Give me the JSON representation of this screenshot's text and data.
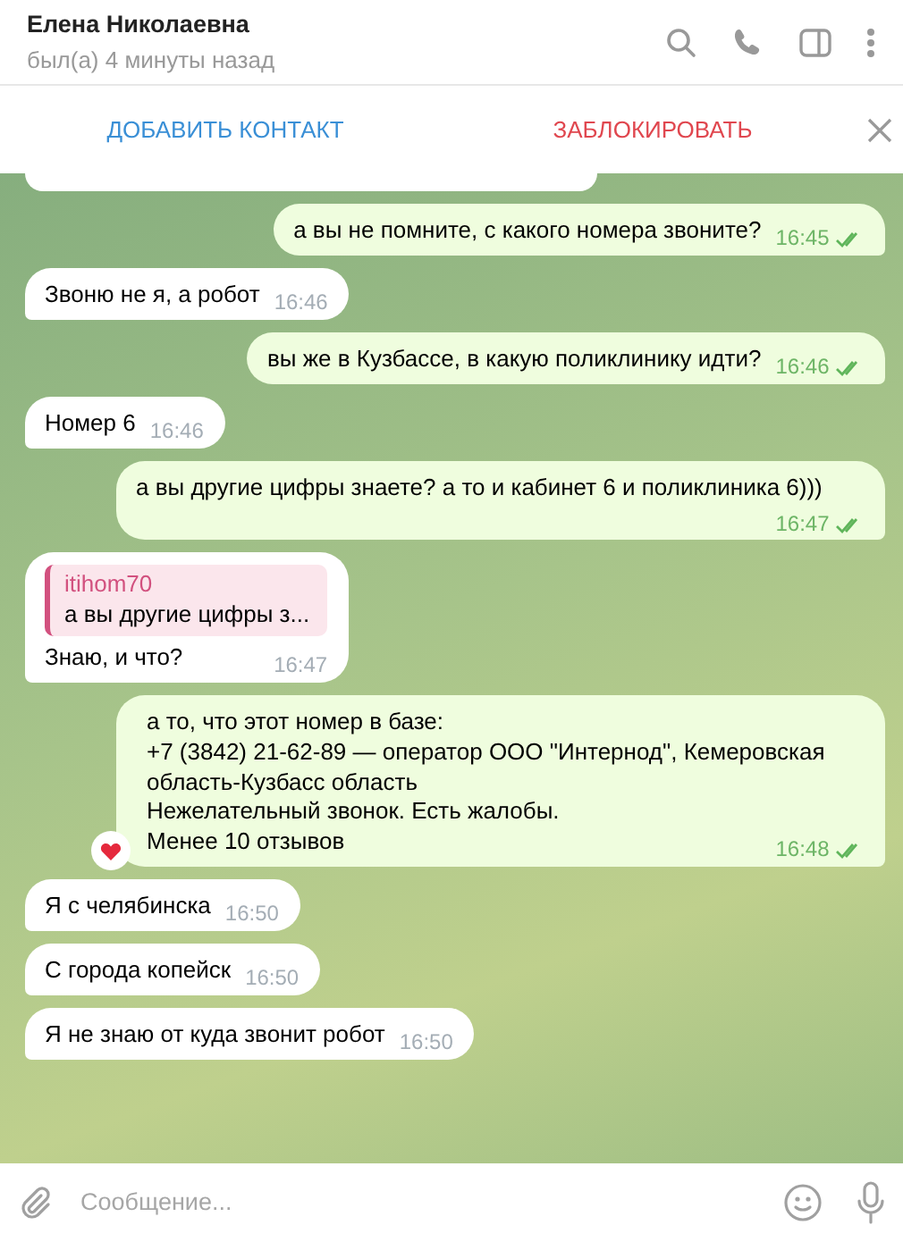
{
  "header": {
    "name": "Елена Николаевна",
    "status": "был(а) 4 минуты назад"
  },
  "action_bar": {
    "add_contact": "ДОБАВИТЬ КОНТАКТ",
    "block": "ЗАБЛОКИРОВАТЬ"
  },
  "messages": [
    {
      "kind": "out",
      "text": "а вы не помните, с какого номера звоните?",
      "time": "16:45",
      "read": true
    },
    {
      "kind": "in",
      "text": "Звоню не я, а робот",
      "time": "16:46"
    },
    {
      "kind": "out",
      "text": "вы же в Кузбассе, в какую поликлинику идти?",
      "time": "16:46",
      "read": true
    },
    {
      "kind": "in",
      "text": "Номер 6",
      "time": "16:46"
    },
    {
      "kind": "out",
      "text": "а вы другие цифры знаете? а то и кабинет 6 и поликлиника 6)))",
      "time": "16:47",
      "read": true
    },
    {
      "kind": "in",
      "reply": {
        "author": "itihom70",
        "text": "а вы другие цифры з..."
      },
      "text": "Знаю, и что?",
      "time": "16:47"
    },
    {
      "kind": "out",
      "lines": [
        "а то, что этот номер в базе:",
        "+7 (3842) 21-62-89 — оператор ООО \"Интернод\", Кемеровская область-Кузбасс область",
        "Нежелательный звонок. Есть жалобы.",
        "Менее 10 отзывов"
      ],
      "time": "16:48",
      "read": true,
      "reaction": true
    },
    {
      "kind": "in",
      "text": "Я с челябинска",
      "time": "16:50"
    },
    {
      "kind": "in",
      "text": "С города копейск",
      "time": "16:50"
    },
    {
      "kind": "in",
      "text": "Я не знаю от куда звонит робот",
      "time": "16:50"
    }
  ],
  "composer": {
    "placeholder": "Сообщение..."
  }
}
